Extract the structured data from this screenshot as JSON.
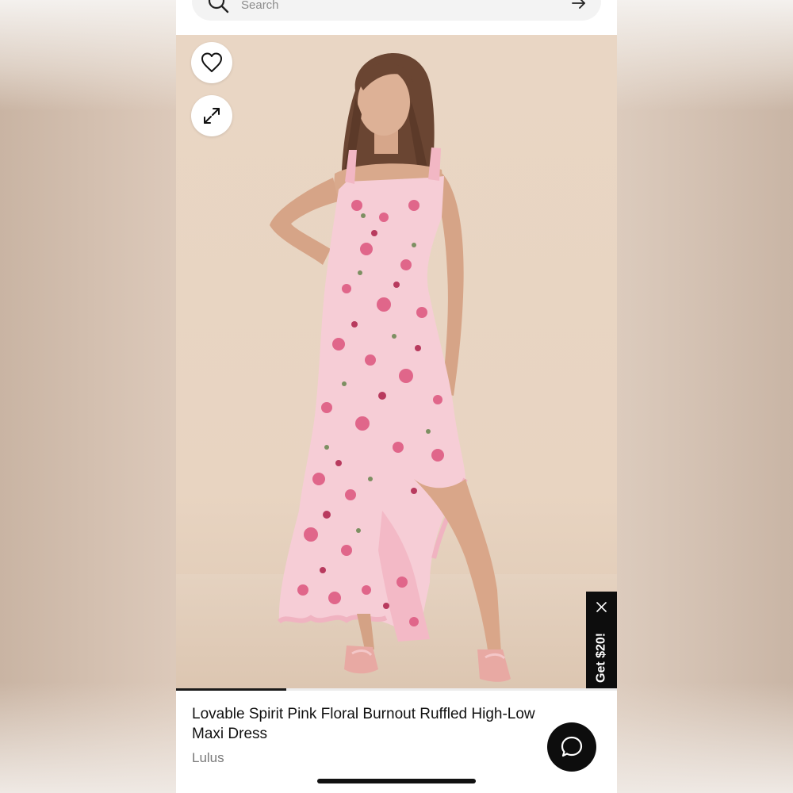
{
  "search": {
    "placeholder": "Search",
    "icon": "search-icon",
    "submit_icon": "arrow-right-icon"
  },
  "gallery": {
    "favorite_icon": "heart-icon",
    "expand_icon": "expand-icon",
    "current_image_progress": 0.25
  },
  "promo": {
    "label": "Get $20!",
    "close_icon": "close-icon"
  },
  "product": {
    "title": "Lovable Spirit Pink Floral Burnout Ruffled High-Low Maxi Dress",
    "brand": "Lulus"
  },
  "chat": {
    "icon": "chat-bubble-icon"
  },
  "colors": {
    "background": "#ffffff",
    "dark": "#0d0d0d",
    "photo_backdrop": "#e9d6c4",
    "dress_pink": "#f6cdd6",
    "flower_pink": "#e0668a",
    "brand_gray": "#7a7a7a"
  }
}
